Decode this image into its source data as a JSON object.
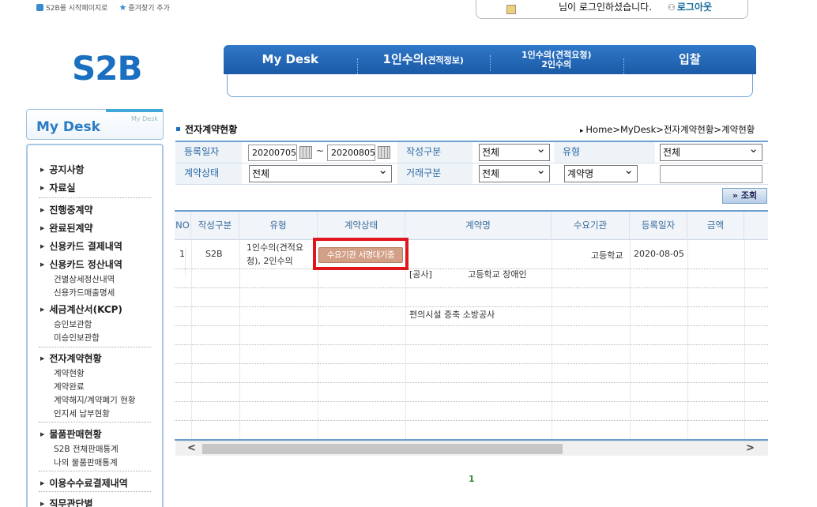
{
  "toplinks": {
    "startpage": "S2B를 시작페이지로",
    "favorite": "즐겨찾기 추가"
  },
  "login": {
    "message": "님이 로그인하셨습니다.",
    "logout": "로그아웃"
  },
  "logo": "S2B",
  "mainnav": {
    "items": [
      {
        "label": "My Desk"
      },
      {
        "label": "1인수의",
        "small": "(견적정보)"
      },
      {
        "label": "1인수의(견적요청)",
        "line2": "2인수의"
      },
      {
        "label": "입찰"
      }
    ]
  },
  "sidebar": {
    "title": "My Desk",
    "title_small": "My Desk",
    "groups": [
      "공지사항",
      "자료실",
      "진행중계약",
      "완료된계약",
      "신용카드 결제내역",
      "신용카드 정산내역",
      "세금계산서(KCP)",
      "전자계약현황",
      "물품판매현황",
      "이용수수료결제내역",
      "직무관단별"
    ],
    "subs": {
      "card_settle": [
        "건별상세정산내역",
        "신용카드매출명세"
      ],
      "tax": [
        "승인보관함",
        "미승인보관함"
      ],
      "econtract": [
        "계약현황",
        "계약완료",
        "계약해지/계약폐기 현황",
        "인지세 납부현황"
      ],
      "sales": [
        "S2B 전체판매통계",
        "나의 물품판매통계"
      ]
    }
  },
  "content": {
    "title": "전자계약현황",
    "breadcrumb": "Home>MyDesk>전자계약현황>계약현황"
  },
  "filters": {
    "reg_date_label": "등록일자",
    "date_from": "20200705",
    "date_sep": "~",
    "date_to": "20200805",
    "write_type_label": "작성구분",
    "write_type_value": "전체",
    "type_label": "유형",
    "type_value": "전체",
    "contract_status_label": "계약상태",
    "contract_status_value": "전체",
    "trade_type_label": "거래구분",
    "trade_type_value": "전체",
    "search_field_value": "계약명",
    "search_text": "",
    "search_button": "조회"
  },
  "table": {
    "headers": [
      "NO",
      "작성구분",
      "유형",
      "계약상태",
      "계약명",
      "수요기관",
      "등록일자",
      "금액"
    ],
    "rows": [
      {
        "no": "1",
        "write_type": "S2B",
        "type_line1": "1인수의(견적요",
        "type_line2": "청), 2인수의",
        "status": "수요기관 서명대기중",
        "name_line1": "[공사]             고등학교 장애인",
        "name_line2": "편의시설 증축 소방공사",
        "agency": "고등학교",
        "reg_date": "2020-08-05",
        "amount": ""
      }
    ]
  },
  "pagination": {
    "current": "1"
  }
}
